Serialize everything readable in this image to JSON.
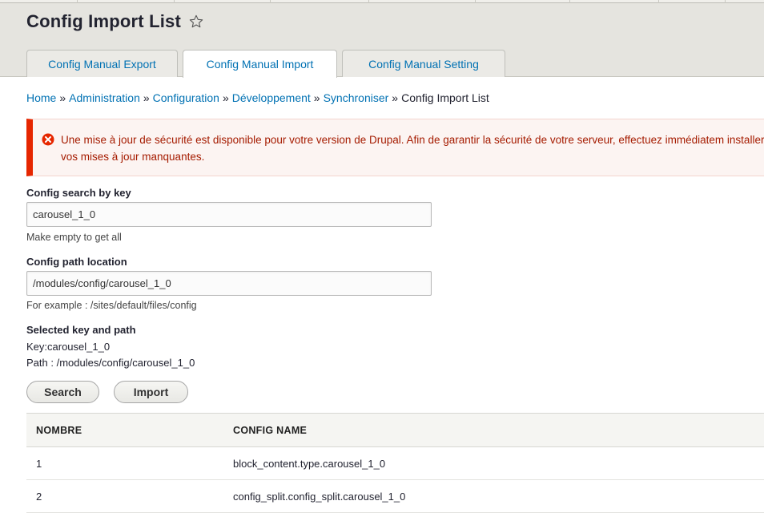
{
  "page": {
    "title": "Config Import List"
  },
  "tabs": [
    {
      "label": "Config Manual Export",
      "active": false
    },
    {
      "label": "Config Manual Import",
      "active": true
    },
    {
      "label": "Config Manual Setting",
      "active": false
    }
  ],
  "breadcrumb": {
    "items": [
      "Home",
      "Administration",
      "Configuration",
      "Développement",
      "Synchroniser"
    ],
    "separator": "»",
    "current": "Config Import List"
  },
  "alert": {
    "message": "Une mise à jour de sécurité est disponible pour votre version de Drupal. Afin de garantir la sécurité de votre serveur, effectuez immédiatem installer vos mises à jour manquantes.",
    "icon": "error-icon",
    "color": "#e62600"
  },
  "form": {
    "search_key": {
      "label": "Config search by key",
      "value": "carousel_1_0",
      "description": "Make empty to get all"
    },
    "path_location": {
      "label": "Config path location",
      "value": "/modules/config/carousel_1_0",
      "description": "For example : /sites/default/files/config"
    },
    "selected": {
      "heading": "Selected key and path",
      "key_line": "Key:carousel_1_0",
      "path_line": "Path : /modules/config/carousel_1_0"
    },
    "buttons": {
      "search": "Search",
      "import": "Import"
    }
  },
  "table": {
    "columns": [
      "NOMBRE",
      "CONFIG NAME"
    ],
    "rows": [
      [
        "1",
        "block_content.type.carousel_1_0"
      ],
      [
        "2",
        "config_split.config_split.carousel_1_0"
      ]
    ]
  },
  "colors": {
    "link": "#0071b3",
    "header_bg": "#e5e4df",
    "alert_text": "#a51b00"
  }
}
